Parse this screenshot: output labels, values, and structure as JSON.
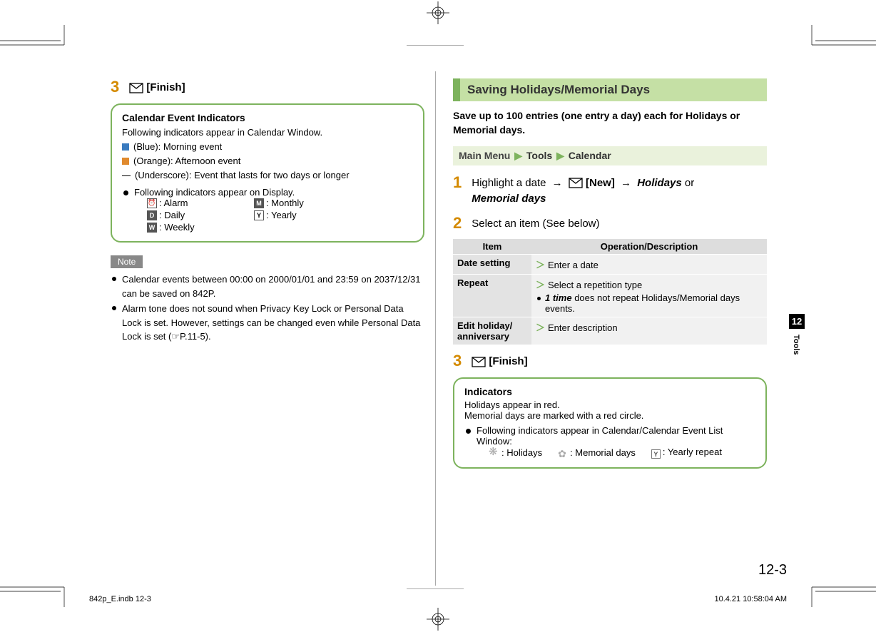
{
  "left": {
    "step3_num": "3",
    "step3_label": "[Finish]",
    "box": {
      "title": "Calendar Event Indicators",
      "intro": "Following indicators appear in Calendar Window.",
      "blue": "(Blue): Morning event",
      "orange": "(Orange): Afternoon event",
      "underscore": "(Underscore): Event that lasts for two days or longer",
      "disp_intro": "Following indicators appear on Display.",
      "ind": {
        "alarm": ": Alarm",
        "monthly": ": Monthly",
        "daily": ": Daily",
        "yearly": ": Yearly",
        "weekly": ": Weekly"
      },
      "letters": {
        "d": "D",
        "w": "W",
        "m": "M",
        "y": "Y"
      }
    },
    "note_label": "Note",
    "notes": [
      "Calendar events between 00:00 on 2000/01/01 and 23:59 on 2037/12/31 can be saved on 842P.",
      "Alarm tone does not sound when Privacy Key Lock or Personal Data Lock is set. However, settings can be changed even while Personal Data Lock is set (☞P.11-5)."
    ]
  },
  "right": {
    "section": "Saving Holidays/Memorial Days",
    "intro": "Save up to 100 entries (one entry a day) each for Holidays or Memorial days.",
    "nav": {
      "main": "Main Menu",
      "a1": "Tools",
      "a2": "Calendar"
    },
    "step1_num": "1",
    "step1_a": "Highlight a date",
    "step1_new": "[New]",
    "step1_hol": "Holidays",
    "step1_or": " or ",
    "step1_mem": "Memorial days",
    "step2_num": "2",
    "step2_text": "Select an item (See below)",
    "table": {
      "h1": "Item",
      "h2": "Operation/Description",
      "r1_item": "Date setting",
      "r1_op": "Enter a date",
      "r2_item": "Repeat",
      "r2_op": "Select a repetition type",
      "r2_sub_b": "1 time",
      "r2_sub_t": " does not repeat Holidays/Memorial days events.",
      "r3_item": "Edit holiday/\nanniversary",
      "r3_op": "Enter description"
    },
    "step3_num": "3",
    "step3_label": "[Finish]",
    "box": {
      "title": "Indicators",
      "l1": "Holidays appear in red.",
      "l2": "Memorial days are marked with a red circle.",
      "intro": "Following indicators appear in Calendar/Calendar Event List Window:",
      "hol": ": Holidays",
      "mem": ": Memorial days",
      "yr": ": Yearly repeat",
      "y": "Y"
    }
  },
  "side": {
    "num": "12",
    "label": "Tools"
  },
  "page_num": "12-3",
  "footer": {
    "left": "842p_E.indb   12-3",
    "right": "10.4.21   10:58:04 AM"
  }
}
